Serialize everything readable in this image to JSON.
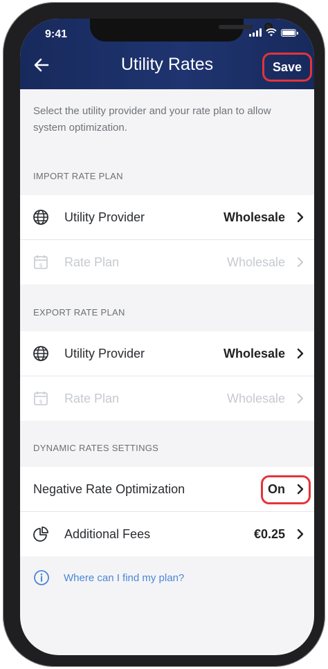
{
  "status_bar": {
    "time": "9:41"
  },
  "header": {
    "title": "Utility Rates",
    "save_label": "Save"
  },
  "intro": "Select the utility provider and your rate plan to allow system optimization.",
  "import_section": {
    "heading": "IMPORT RATE PLAN",
    "rows": [
      {
        "label": "Utility Provider",
        "value": "Wholesale",
        "icon": "globe-icon",
        "enabled": true
      },
      {
        "label": "Rate Plan",
        "value": "Wholesale",
        "icon": "calendar-dollar-icon",
        "enabled": false
      }
    ]
  },
  "export_section": {
    "heading": "EXPORT RATE PLAN",
    "rows": [
      {
        "label": "Utility Provider",
        "value": "Wholesale",
        "icon": "globe-icon",
        "enabled": true
      },
      {
        "label": "Rate Plan",
        "value": "Wholesale",
        "icon": "calendar-dollar-icon",
        "enabled": false
      }
    ]
  },
  "dynamic_section": {
    "heading": "DYNAMIC RATES SETTINGS",
    "rows": [
      {
        "label": "Negative Rate Optimization",
        "value": "On"
      },
      {
        "label": "Additional Fees",
        "value": "€0.25",
        "icon": "pie-chart-icon"
      }
    ]
  },
  "help": {
    "text": "Where can I find my plan?",
    "icon": "info-icon"
  },
  "colors": {
    "header": "#1f3470",
    "highlight": "#e3343a",
    "link": "#4a86d6"
  }
}
